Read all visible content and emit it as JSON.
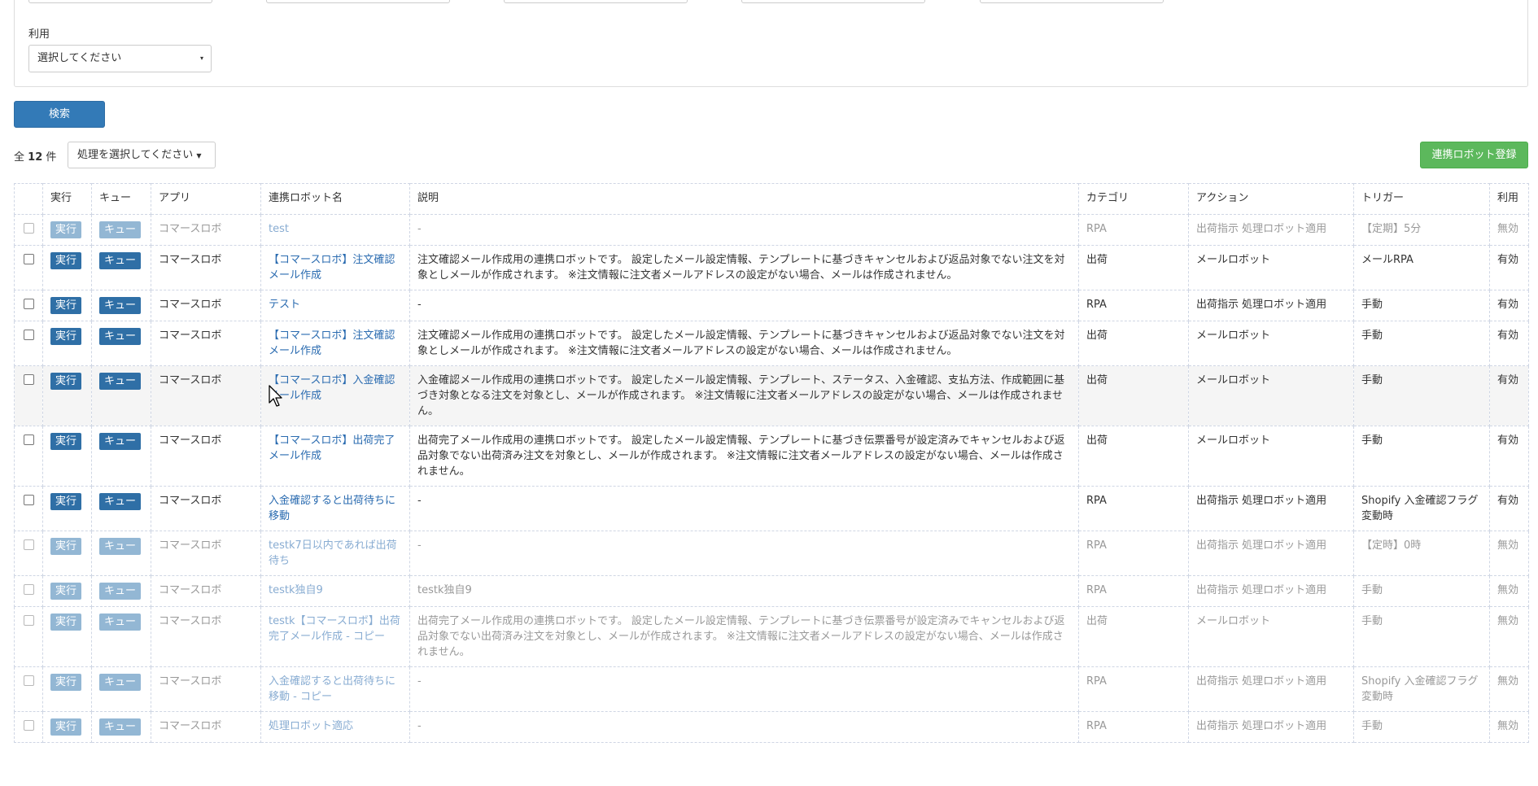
{
  "filter": {
    "label": "利用",
    "select_value": "選択してください"
  },
  "search_label": "検索",
  "count": {
    "prefix": "全",
    "value": "12",
    "suffix": "件"
  },
  "process_dropdown": "処理を選択してください",
  "register_label": "連携ロボット登録",
  "table": {
    "headers": [
      "実行",
      "キュー",
      "アプリ",
      "連携ロボット名",
      "説明",
      "カテゴリ",
      "アクション",
      "トリガー",
      "利用"
    ],
    "run_label": "実行",
    "queue_label": "キュー",
    "rows": [
      {
        "app": "コマースロボ",
        "name": "test",
        "desc": "-",
        "category": "RPA",
        "action": "出荷指示 処理ロボット適用",
        "trigger": "【定期】5分",
        "status": "無効",
        "active": false
      },
      {
        "app": "コマースロボ",
        "name": "【コマースロボ】注文確認メール作成",
        "desc": "注文確認メール作成用の連携ロボットです。 設定したメール設定情報、テンプレートに基づきキャンセルおよび返品対象でない注文を対象としメールが作成されます。 ※注文情報に注文者メールアドレスの設定がない場合、メールは作成されません。",
        "category": "出荷",
        "action": "メールロボット",
        "trigger": "メールRPA",
        "status": "有効",
        "active": true
      },
      {
        "app": "コマースロボ",
        "name": "テスト",
        "desc": "-",
        "category": "RPA",
        "action": "出荷指示 処理ロボット適用",
        "trigger": "手動",
        "status": "有効",
        "active": true
      },
      {
        "app": "コマースロボ",
        "name": "【コマースロボ】注文確認メール作成",
        "desc": "注文確認メール作成用の連携ロボットです。 設定したメール設定情報、テンプレートに基づきキャンセルおよび返品対象でない注文を対象としメールが作成されます。 ※注文情報に注文者メールアドレスの設定がない場合、メールは作成されません。",
        "category": "出荷",
        "action": "メールロボット",
        "trigger": "手動",
        "status": "有効",
        "active": true
      },
      {
        "app": "コマースロボ",
        "name": "【コマースロボ】入金確認メール作成",
        "desc": "入金確認メール作成用の連携ロボットです。 設定したメール設定情報、テンプレート、ステータス、入金確認、支払方法、作成範囲に基づき対象となる注文を対象とし、メールが作成されます。 ※注文情報に注文者メールアドレスの設定がない場合、メールは作成されません。",
        "category": "出荷",
        "action": "メールロボット",
        "trigger": "手動",
        "status": "有効",
        "active": true
      },
      {
        "app": "コマースロボ",
        "name": "【コマースロボ】出荷完了メール作成",
        "desc": "出荷完了メール作成用の連携ロボットです。 設定したメール設定情報、テンプレートに基づき伝票番号が設定済みでキャンセルおよび返品対象でない出荷済み注文を対象とし、メールが作成されます。 ※注文情報に注文者メールアドレスの設定がない場合、メールは作成されません。",
        "category": "出荷",
        "action": "メールロボット",
        "trigger": "手動",
        "status": "有効",
        "active": true
      },
      {
        "app": "コマースロボ",
        "name": "入金確認すると出荷待ちに移動",
        "desc": "-",
        "category": "RPA",
        "action": "出荷指示 処理ロボット適用",
        "trigger": "Shopify 入金確認フラグ変動時",
        "status": "有効",
        "active": true
      },
      {
        "app": "コマースロボ",
        "name": "testk7日以内であれば出荷待ち",
        "desc": "-",
        "category": "RPA",
        "action": "出荷指示 処理ロボット適用",
        "trigger": "【定時】0時",
        "status": "無効",
        "active": false
      },
      {
        "app": "コマースロボ",
        "name": "testk独自9",
        "desc": "testk独自9",
        "category": "RPA",
        "action": "出荷指示 処理ロボット適用",
        "trigger": "手動",
        "status": "無効",
        "active": false
      },
      {
        "app": "コマースロボ",
        "name": "testk【コマースロボ】出荷完了メール作成 - コピー",
        "desc": "出荷完了メール作成用の連携ロボットです。 設定したメール設定情報、テンプレートに基づき伝票番号が設定済みでキャンセルおよび返品対象でない出荷済み注文を対象とし、メールが作成されます。 ※注文情報に注文者メールアドレスの設定がない場合、メールは作成されません。",
        "category": "出荷",
        "action": "メールロボット",
        "trigger": "手動",
        "status": "無効",
        "active": false
      },
      {
        "app": "コマースロボ",
        "name": "入金確認すると出荷待ちに移動 - コピー",
        "desc": "-",
        "category": "RPA",
        "action": "出荷指示 処理ロボット適用",
        "trigger": "Shopify 入金確認フラグ変動時",
        "status": "無効",
        "active": false
      },
      {
        "app": "コマースロボ",
        "name": "処理ロボット適応",
        "desc": "-",
        "category": "RPA",
        "action": "出荷指示 処理ロボット適用",
        "trigger": "手動",
        "status": "無効",
        "active": false
      }
    ]
  }
}
